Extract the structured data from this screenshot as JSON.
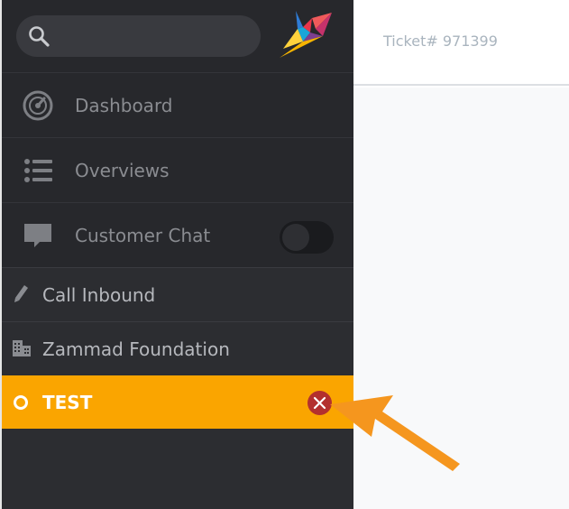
{
  "search": {
    "placeholder": "",
    "value": ""
  },
  "nav": [
    {
      "label": "Dashboard",
      "icon": "dashboard-icon"
    },
    {
      "label": "Overviews",
      "icon": "list-icon"
    },
    {
      "label": "Customer Chat",
      "icon": "chat-bubble-icon",
      "toggle_on": false
    }
  ],
  "tasks": [
    {
      "label": "Call Inbound",
      "icon": "pencil-icon",
      "active": false
    },
    {
      "label": "Zammad Foundation",
      "icon": "building-icon",
      "active": false
    },
    {
      "label": "TEST",
      "icon": "status-ring-icon",
      "active": true
    }
  ],
  "header": {
    "ticket_label": "Ticket# 971399"
  },
  "colors": {
    "sidebar": "#2c2d31",
    "active_task": "#faa500",
    "close_button": "#b3302e",
    "arrow": "#f5961e"
  }
}
